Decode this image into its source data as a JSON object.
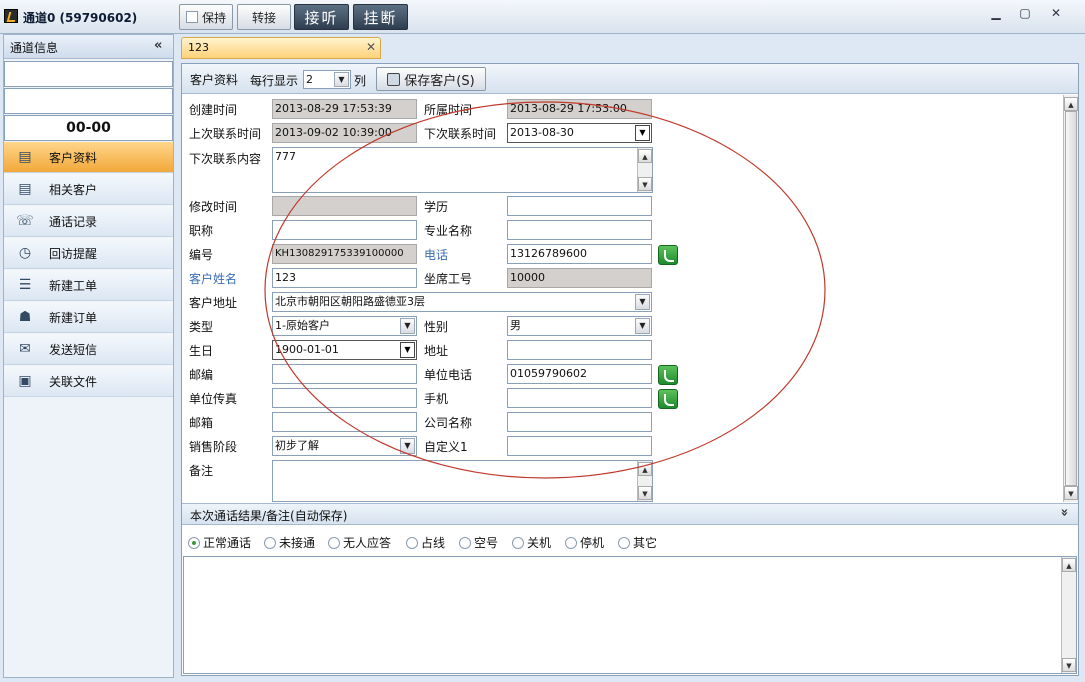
{
  "titlebar": {
    "title": "通道0 (59790602)",
    "hold_label": "保持",
    "transfer_label": "转接",
    "answer_label": "接听",
    "hangup_label": "挂断",
    "min_icon": "minimize-icon",
    "max_icon": "maximize-icon",
    "close_icon": "close-icon"
  },
  "sidebar": {
    "header": "通道信息",
    "collapse_glyph": "«",
    "field1": "",
    "field2": "",
    "timer": "00-00",
    "items": [
      {
        "label": "客户资料",
        "icon": "contact-card-icon",
        "active": true
      },
      {
        "label": "相关客户",
        "icon": "contact-card-icon",
        "active": false
      },
      {
        "label": "通话记录",
        "icon": "phone-icon",
        "active": false
      },
      {
        "label": "回访提醒",
        "icon": "clock-icon",
        "active": false
      },
      {
        "label": "新建工单",
        "icon": "person-list-icon",
        "active": false
      },
      {
        "label": "新建订单",
        "icon": "order-icon",
        "active": false
      },
      {
        "label": "发送短信",
        "icon": "envelope-icon",
        "active": false
      },
      {
        "label": "关联文件",
        "icon": "file-icon",
        "active": false
      }
    ]
  },
  "tab": {
    "label": "123",
    "close_glyph": "✕"
  },
  "toolbar": {
    "section_label": "客户资料",
    "per_row_label": "每行显示",
    "per_row_value": "2",
    "cols_label": "列",
    "save_label": "保存客户(S)"
  },
  "form": {
    "created_label": "创建时间",
    "created_value": "2013-08-29 17:53:39",
    "belong_label": "所属时间",
    "belong_value": "2013-08-29 17:53:00",
    "last_contact_label": "上次联系时间",
    "last_contact_value": "2013-09-02 10:39:00",
    "next_contact_label": "下次联系时间",
    "next_contact_value": "2013-08-30",
    "next_content_label": "下次联系内容",
    "next_content_value": "777",
    "modified_label": "修改时间",
    "modified_value": "",
    "education_label": "学历",
    "education_value": "",
    "title_label": "职称",
    "title_value": "",
    "major_label": "专业名称",
    "major_value": "",
    "code_label": "编号",
    "code_value": "KH130829175339100000",
    "phone_label": "电话",
    "phone_value": "13126789600",
    "name_label": "客户姓名",
    "name_value": "123",
    "agent_label": "坐席工号",
    "agent_value": "10000",
    "address_label": "客户地址",
    "address_value": "北京市朝阳区朝阳路盛德亚3层",
    "type_label": "类型",
    "type_value": "1-原始客户",
    "gender_label": "性别",
    "gender_value": "男",
    "birthday_label": "生日",
    "birthday_value": "1900-01-01",
    "addr2_label": "地址",
    "addr2_value": "",
    "zip_label": "邮编",
    "zip_value": "",
    "work_phone_label": "单位电话",
    "work_phone_value": "01059790602",
    "fax_label": "单位传真",
    "fax_value": "",
    "mobile_label": "手机",
    "mobile_value": "",
    "email_label": "邮箱",
    "email_value": "",
    "company_label": "公司名称",
    "company_value": "",
    "stage_label": "销售阶段",
    "stage_value": "初步了解",
    "custom1_label": "自定义1",
    "custom1_value": "",
    "remark_label": "备注",
    "remark_value": ""
  },
  "result": {
    "header": "本次通话结果/备注(自动保存)",
    "expand_glyph": "»",
    "options": [
      "正常通话",
      "未接通",
      "无人应答",
      "占线",
      "空号",
      "关机",
      "停机",
      "其它"
    ],
    "selected": "正常通话",
    "notes": ""
  },
  "colors": {
    "accent_orange": "#f2a83a",
    "annotation_ellipse": "#c0392b",
    "label_blue": "#3a6db5"
  }
}
